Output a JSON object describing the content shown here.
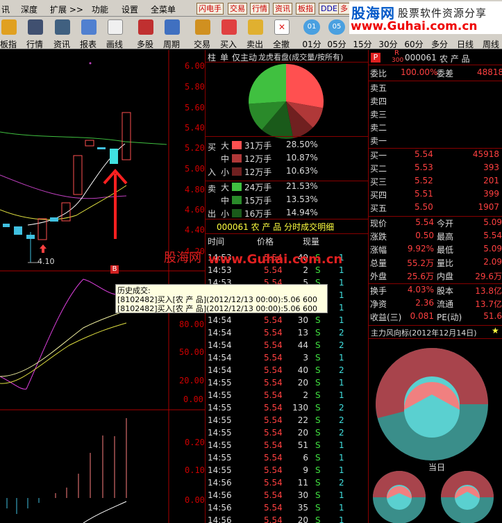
{
  "menu": {
    "items": [
      "讯",
      "深度",
      "扩展 >>",
      "功能",
      "设置",
      "全菜单"
    ],
    "hot_buttons": [
      "闪电手",
      "交易",
      "行情",
      "资讯",
      "板指",
      "DDE",
      "多"
    ]
  },
  "logo": {
    "name": "股海网",
    "slogan": "股票软件资源分享",
    "url": "www.Guhai.com.cn"
  },
  "toolbar": {
    "buttons": [
      "板指",
      "行情",
      "资讯",
      "报表",
      "画线",
      "多股",
      "周期",
      "交易",
      "买入",
      "卖出",
      "全撤"
    ],
    "periods": [
      {
        "top": "01",
        "label": "01分"
      },
      {
        "top": "05",
        "label": "05分"
      },
      {
        "top": "",
        "label": "15分"
      },
      {
        "top": "",
        "label": "30分"
      },
      {
        "top": "",
        "label": "60分"
      },
      {
        "top": "",
        "label": "多分"
      },
      {
        "top": "",
        "label": "日线"
      },
      {
        "top": "",
        "label": "周线"
      }
    ]
  },
  "kline": {
    "price_axis": [
      "6.00",
      "5.80",
      "5.60",
      "5.40",
      "5.20",
      "5.00",
      "4.80",
      "4.60",
      "4.40",
      "4.20"
    ],
    "low_label": "4.10",
    "marker": "B",
    "indicator_axis": [
      "80.00",
      "50.00",
      "20.00",
      "0.00"
    ],
    "volume_axis": [
      "0.20",
      "0.10",
      "0.00"
    ]
  },
  "watermark": {
    "text1": "股海网",
    "text2": "www.Guhai.com.cn"
  },
  "tooltip": {
    "title": "历史成交:",
    "lines": [
      "[8102482]买入[农 产 品](2012/12/13 00:00):5.06 600",
      "[8102482]买入[农 产 品](2012/12/13 00:00):5.06 600"
    ]
  },
  "dragon": {
    "tabs": [
      "柱",
      "单",
      "仅主动",
      "龙虎看盘(成交量/按所有)"
    ],
    "buy_label": [
      "买",
      "入"
    ],
    "sell_label": [
      "卖",
      "出"
    ],
    "buy": [
      {
        "size": "大",
        "amount": "31万手",
        "pct": "28.50%",
        "color": "#ff5050"
      },
      {
        "size": "中",
        "amount": "12万手",
        "pct": "10.87%",
        "color": "#b03838"
      },
      {
        "size": "小",
        "amount": "12万手",
        "pct": "10.63%",
        "color": "#702020"
      }
    ],
    "sell": [
      {
        "size": "大",
        "amount": "24万手",
        "pct": "21.53%",
        "color": "#40c040"
      },
      {
        "size": "中",
        "amount": "15万手",
        "pct": "13.53%",
        "color": "#2a8a2a"
      },
      {
        "size": "小",
        "amount": "16万手",
        "pct": "14.94%",
        "color": "#1a5a1a"
      }
    ]
  },
  "ticks": {
    "title": "000061 农 产 品 分时成交明细",
    "headers": [
      "时间",
      "价格",
      "现量"
    ],
    "rows": [
      {
        "t": "14:53",
        "p": "5.54",
        "v": "40",
        "d": "S",
        "n": "1"
      },
      {
        "t": "14:53",
        "p": "5.54",
        "v": "2",
        "d": "S",
        "n": "1"
      },
      {
        "t": "14:53",
        "p": "5.54",
        "v": "5",
        "d": "S",
        "n": "1"
      },
      {
        "t": "14:53",
        "p": "5.54",
        "v": "8",
        "d": "S",
        "n": "1"
      },
      {
        "t": "14:54",
        "p": "5.54",
        "v": "",
        "d": "S",
        "n": "1"
      },
      {
        "t": "14:54",
        "p": "5.54",
        "v": "30",
        "d": "S",
        "n": "1"
      },
      {
        "t": "14:54",
        "p": "5.54",
        "v": "13",
        "d": "S",
        "n": "2"
      },
      {
        "t": "14:54",
        "p": "5.54",
        "v": "44",
        "d": "S",
        "n": "2"
      },
      {
        "t": "14:54",
        "p": "5.54",
        "v": "3",
        "d": "S",
        "n": "1"
      },
      {
        "t": "14:54",
        "p": "5.54",
        "v": "40",
        "d": "S",
        "n": "2"
      },
      {
        "t": "14:55",
        "p": "5.54",
        "v": "20",
        "d": "S",
        "n": "1"
      },
      {
        "t": "14:55",
        "p": "5.54",
        "v": "2",
        "d": "S",
        "n": "1"
      },
      {
        "t": "14:55",
        "p": "5.54",
        "v": "130",
        "d": "S",
        "n": "2"
      },
      {
        "t": "14:55",
        "p": "5.54",
        "v": "22",
        "d": "S",
        "n": "2"
      },
      {
        "t": "14:55",
        "p": "5.54",
        "v": "20",
        "d": "S",
        "n": "2"
      },
      {
        "t": "14:55",
        "p": "5.54",
        "v": "51",
        "d": "S",
        "n": "1"
      },
      {
        "t": "14:55",
        "p": "5.54",
        "v": "6",
        "d": "S",
        "n": "1"
      },
      {
        "t": "14:55",
        "p": "5.54",
        "v": "9",
        "d": "S",
        "n": "1"
      },
      {
        "t": "14:56",
        "p": "5.54",
        "v": "11",
        "d": "S",
        "n": "2"
      },
      {
        "t": "14:56",
        "p": "5.54",
        "v": "30",
        "d": "S",
        "n": "1"
      },
      {
        "t": "14:56",
        "p": "5.54",
        "v": "35",
        "d": "S",
        "n": "1"
      },
      {
        "t": "14:56",
        "p": "5.54",
        "v": "20",
        "d": "S",
        "n": "1"
      }
    ]
  },
  "quote": {
    "code": "000061",
    "name": "农 产 品",
    "badge": "P",
    "r_label": "R",
    "r_num": "300",
    "wb_label": "委比",
    "wb": "100.00%",
    "wc_label": "委差",
    "wc": "48818",
    "sell": [
      {
        "l": "卖五",
        "p": "",
        "v": ""
      },
      {
        "l": "卖四",
        "p": "",
        "v": ""
      },
      {
        "l": "卖三",
        "p": "",
        "v": ""
      },
      {
        "l": "卖二",
        "p": "",
        "v": ""
      },
      {
        "l": "卖一",
        "p": "",
        "v": ""
      }
    ],
    "buy": [
      {
        "l": "买一",
        "p": "5.54",
        "v": "45918"
      },
      {
        "l": "买二",
        "p": "5.53",
        "v": "393"
      },
      {
        "l": "买三",
        "p": "5.52",
        "v": "201"
      },
      {
        "l": "买四",
        "p": "5.51",
        "v": "399"
      },
      {
        "l": "买五",
        "p": "5.50",
        "v": "1907"
      }
    ],
    "stats": [
      {
        "a": "现价",
        "av": "5.54",
        "b": "今开",
        "bv": "5.09"
      },
      {
        "a": "涨跌",
        "av": "0.50",
        "b": "最高",
        "bv": "5.54"
      },
      {
        "a": "涨幅",
        "av": "9.92%",
        "b": "最低",
        "bv": "5.09"
      },
      {
        "a": "总量",
        "av": "55.2万",
        "b": "量比",
        "bv": "2.09"
      },
      {
        "a": "外盘",
        "av": "25.6万",
        "b": "内盘",
        "bv": "29.6万"
      }
    ],
    "stats2": [
      {
        "a": "换手",
        "av": "4.03%",
        "b": "股本",
        "bv": "13.8亿"
      },
      {
        "a": "净资",
        "av": "2.36",
        "b": "流通",
        "bv": "13.7亿"
      },
      {
        "a": "收益(三)",
        "av": "0.081",
        "b": "PE(动)",
        "bv": "51.6"
      }
    ]
  },
  "fund": {
    "title": "主力风向标(2012年12月14日)",
    "today_label": "当日"
  }
}
